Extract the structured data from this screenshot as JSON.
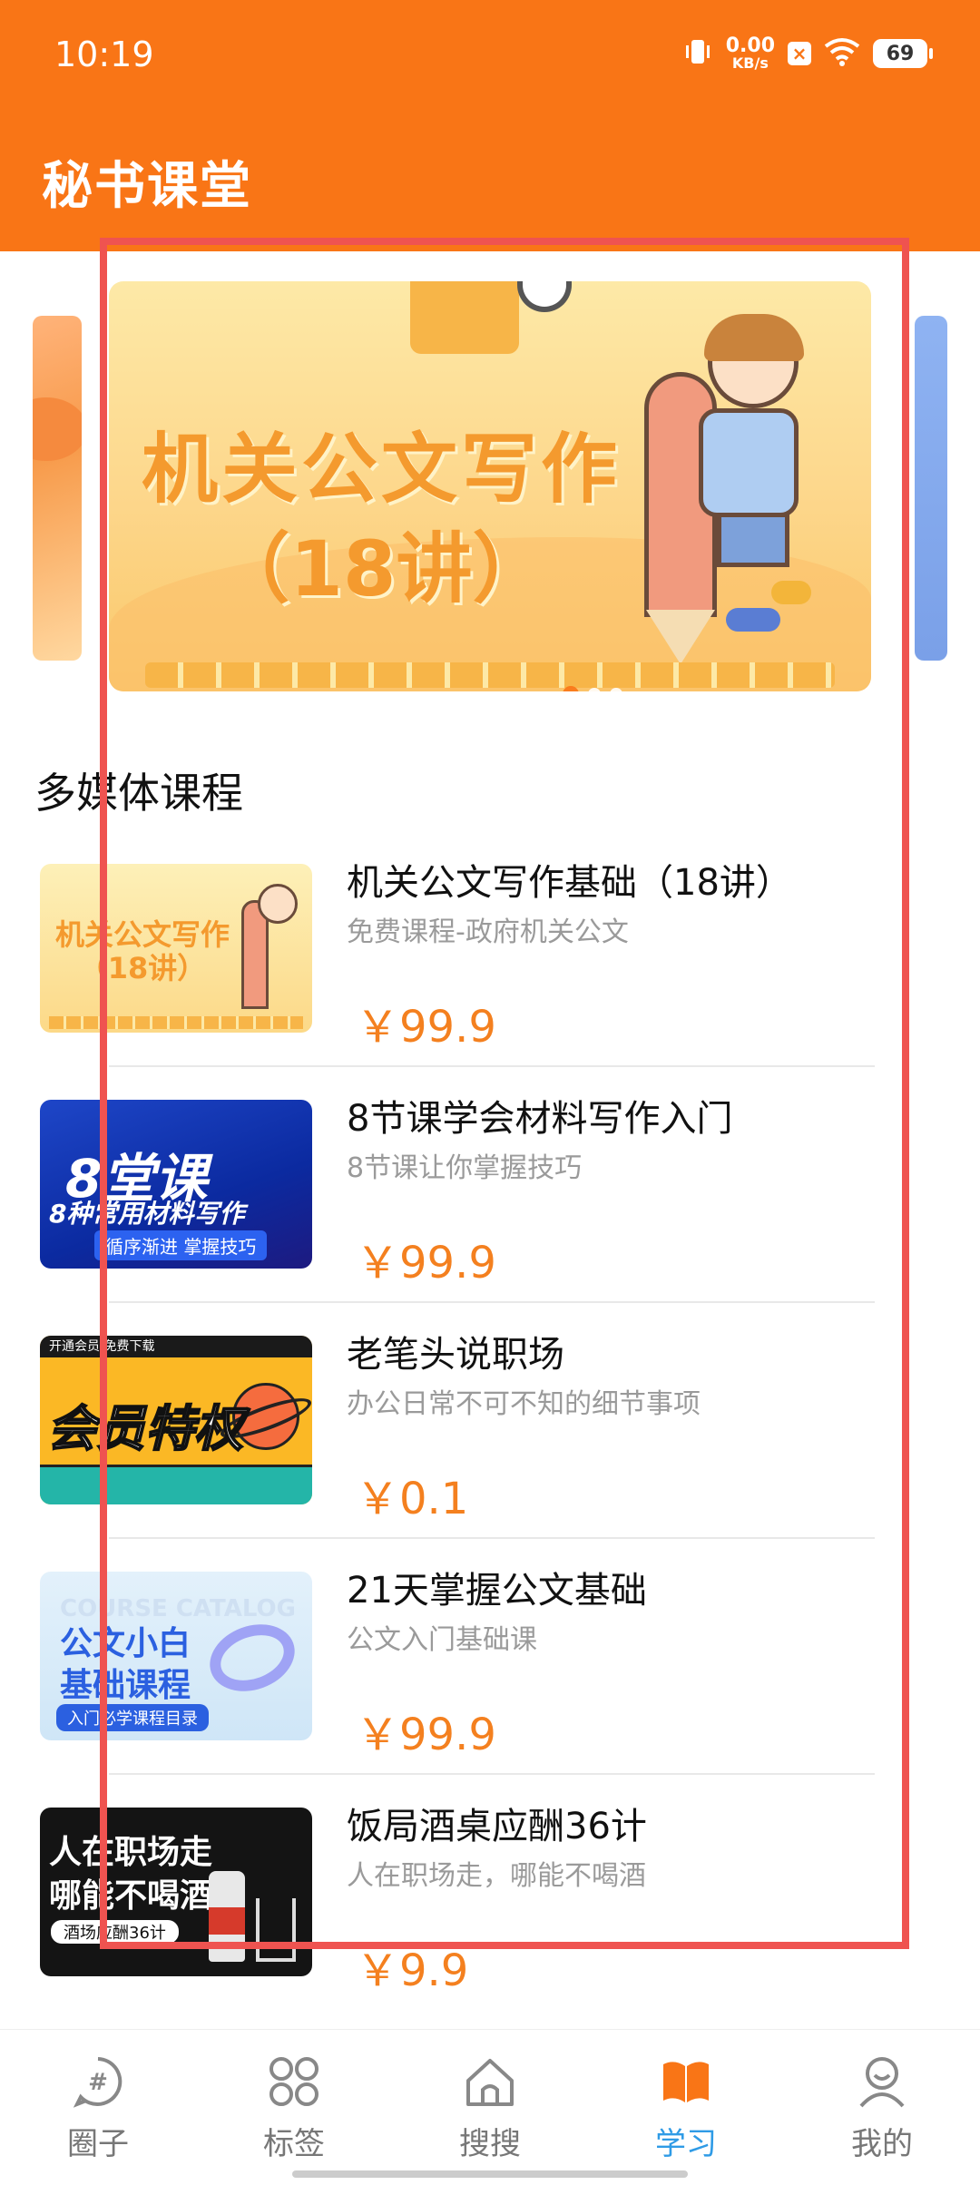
{
  "status_bar": {
    "time": "10:19",
    "net_speed_value": "0.00",
    "net_speed_unit": "KB/s",
    "battery": "69",
    "icons": [
      "vibrate-icon",
      "close-badge-icon",
      "wifi-icon",
      "battery-icon"
    ]
  },
  "header": {
    "title": "秘书课堂",
    "color": "#F97516"
  },
  "banner": {
    "line1": "机关公文写作",
    "line2": "（18讲）",
    "page_count": 3,
    "active_index": 0
  },
  "section": {
    "title": "多媒体课程"
  },
  "courses": [
    {
      "title": "机关公文写作基础（18讲）",
      "subtitle": "免费课程-政府机关公文",
      "price": "￥99.9",
      "thumb_text": "机关公文写作（18讲）"
    },
    {
      "title": "8节课学会材料写作入门",
      "subtitle": "8节课让你掌握技巧",
      "price": "￥99.9",
      "thumb_big": "8堂课",
      "thumb_mid": "8种常用材料写作",
      "thumb_tag": "循序渐进 掌握技巧"
    },
    {
      "title": "老笔头说职场",
      "subtitle": "办公日常不可不知的细节事项",
      "price": "￥0.1",
      "thumb_top": "开通会员 免费下载",
      "thumb_big": "会员特权"
    },
    {
      "title": "21天掌握公文基础",
      "subtitle": "公文入门基础课",
      "price": "￥99.9",
      "thumb_ghost": "COURSE CATALOG",
      "thumb_l1": "公文小白",
      "thumb_l2": "基础课程",
      "thumb_pill": "入门必学课程目录"
    },
    {
      "title": "饭局酒桌应酬36计",
      "subtitle": "人在职场走，哪能不喝酒",
      "price": "￥9.9",
      "thumb_l1": "人在职场走",
      "thumb_l2": "哪能不喝酒",
      "thumb_pill": "酒场应酬36计"
    }
  ],
  "bottom_nav": [
    {
      "label": "圈子",
      "icon": "hashtag-circle-icon",
      "active": false
    },
    {
      "label": "标签",
      "icon": "four-petal-icon",
      "active": false
    },
    {
      "label": "搜搜",
      "icon": "home-icon",
      "active": false
    },
    {
      "label": "学习",
      "icon": "book-icon",
      "active": true
    },
    {
      "label": "我的",
      "icon": "user-icon",
      "active": false
    }
  ],
  "colors": {
    "accent": "#F97516",
    "price": "#F4801F",
    "nav_active": "#2F9BE6",
    "highlight_box": "#EF5350"
  }
}
